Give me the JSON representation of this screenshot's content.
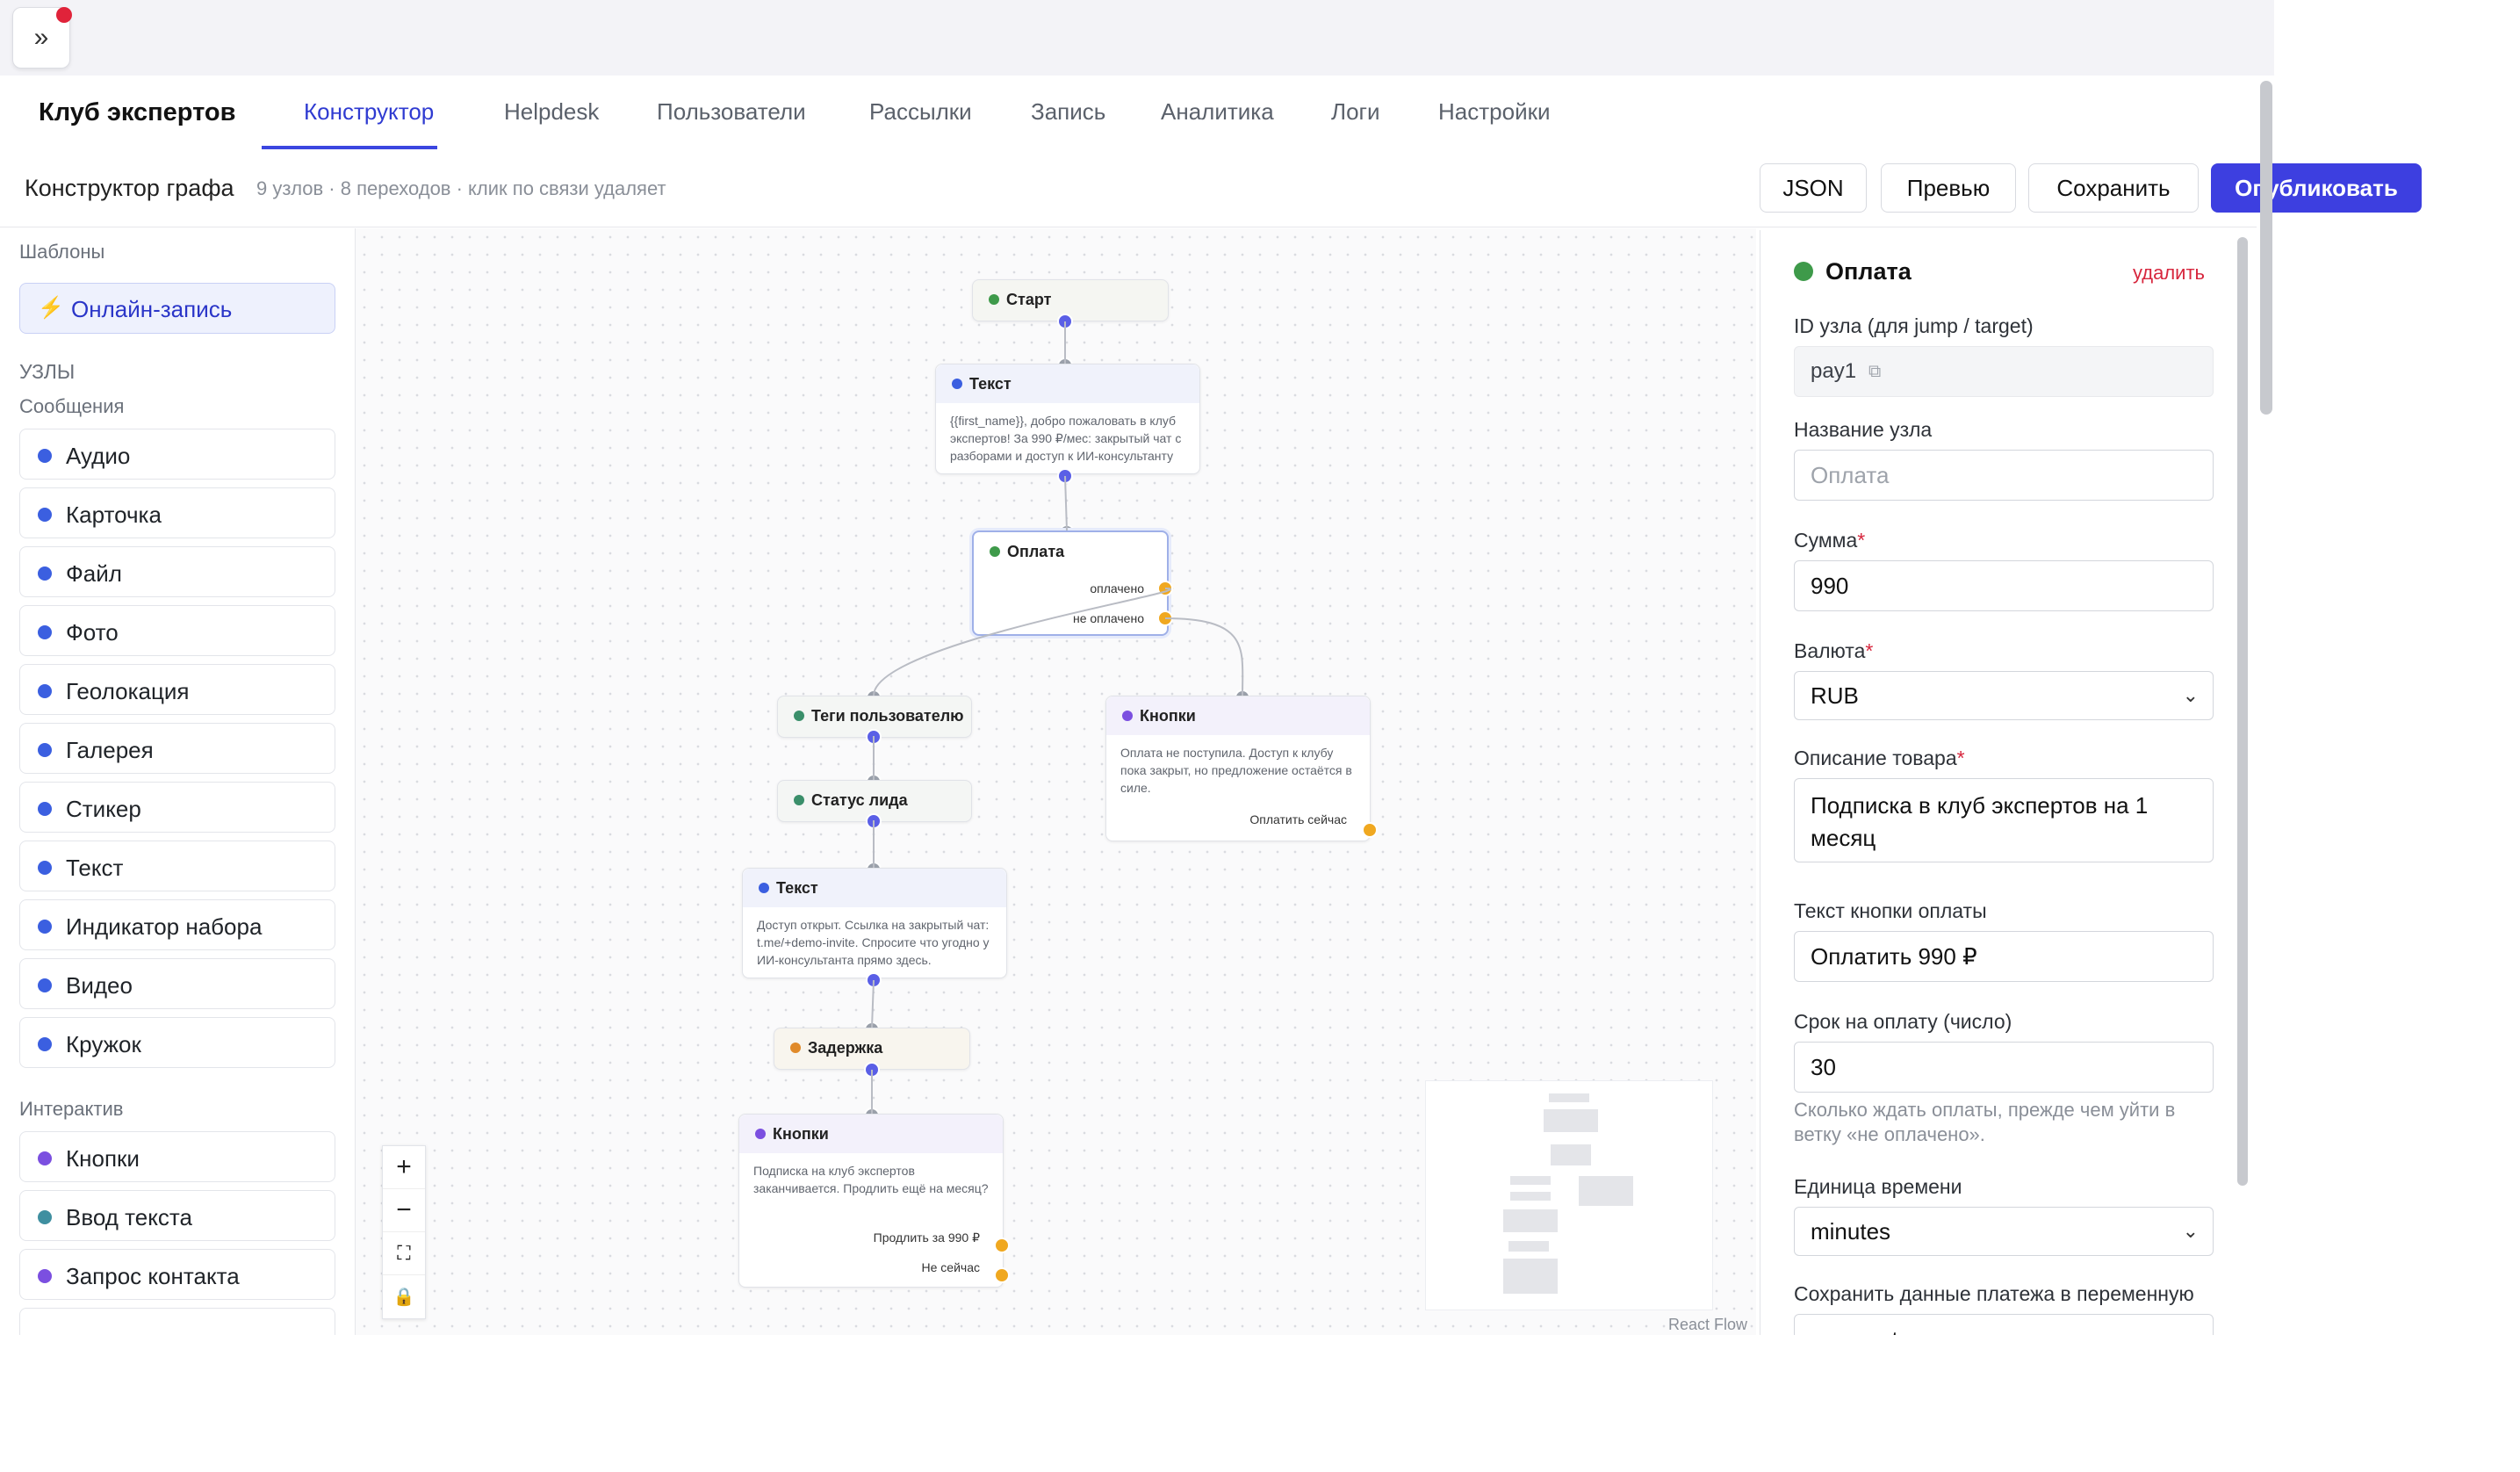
{
  "window": {
    "expand_icon": "»"
  },
  "nav": {
    "brand": "Клуб экспертов",
    "tabs": [
      "Конструктор",
      "Helpdesk",
      "Пользователи",
      "Рассылки",
      "Запись",
      "Аналитика",
      "Логи",
      "Настройки"
    ],
    "active_tab": "Конструктор"
  },
  "toolbar": {
    "title": "Конструктор графа",
    "subtitle": "9 узлов · 8 переходов · клик по связи удаляет",
    "json_label": "JSON",
    "preview_label": "Превью",
    "save_label": "Сохранить",
    "publish_label": "Опубликовать"
  },
  "sidebar": {
    "templates_heading": "Шаблоны",
    "template_item": "Онлайн-запись",
    "nodes_heading": "УЗЛЫ",
    "messages_heading": "Сообщения",
    "messages": [
      "Аудио",
      "Карточка",
      "Файл",
      "Фото",
      "Геолокация",
      "Галерея",
      "Стикер",
      "Текст",
      "Индикатор набора",
      "Видео",
      "Кружок"
    ],
    "interactive_heading": "Интерактив",
    "interactive": [
      "Кнопки",
      "Ввод текста",
      "Запрос контакта"
    ]
  },
  "canvas": {
    "nodes": {
      "start": {
        "title": "Старт"
      },
      "text1": {
        "title": "Текст",
        "body": "{{first_name}}, добро пожаловать в клуб экспертов! За 990 ₽/мес: закрытый чат с разборами и доступ к ИИ-консультанту по маркетингу."
      },
      "pay": {
        "title": "Оплата",
        "port_paid": "оплачено",
        "port_unpaid": "не оплачено"
      },
      "tags": {
        "title": "Теги пользователю"
      },
      "buttons1": {
        "title": "Кнопки",
        "body": "Оплата не поступила. Доступ к клубу пока закрыт, но предложение остаётся в силе.",
        "port1": "Оплатить сейчас"
      },
      "status": {
        "title": "Статус лида"
      },
      "text2": {
        "title": "Текст",
        "body": "Доступ открыт. Ссылка на закрытый чат: t.me/+demo-invite. Спросите что угодно у ИИ-консультанта прямо здесь."
      },
      "delay": {
        "title": "Задержка"
      },
      "buttons2": {
        "title": "Кнопки",
        "body": "Подписка на клуб экспертов заканчивается. Продлить ещё на месяц?",
        "port1": "Продлить за 990 ₽",
        "port2": "Не сейчас"
      }
    },
    "controls": {
      "zoom_in": "+",
      "zoom_out": "−",
      "fit": "⛶",
      "lock": "🔒"
    },
    "attribution": "React Flow"
  },
  "panel": {
    "title": "Оплата",
    "delete_label": "удалить",
    "id_label": "ID узла (для jump / target)",
    "id_value": "pay1",
    "name_label": "Название узла",
    "name_placeholder": "Оплата",
    "amount_label": "Сумма",
    "amount_value": "990",
    "currency_label": "Валюта",
    "currency_value": "RUB",
    "desc_label": "Описание товара",
    "desc_value": "Подписка в клуб экспертов на 1 месяц",
    "btn_text_label": "Текст кнопки оплаты",
    "btn_text_value": "Оплатить 990 ₽",
    "term_label": "Срок на оплату (число)",
    "term_value": "30",
    "term_help": "Сколько ждать оплаты, прежде чем уйти в ветку «не оплачено».",
    "unit_label": "Единица времени",
    "unit_value": "minutes",
    "save_var_label": "Сохранить данные платежа в переменную",
    "save_var_value": "payment",
    "required_mark": "*"
  },
  "colors": {
    "accent": "#3d3fe0",
    "start_node": "#3e9a4a",
    "message_node": "#3b5fe0",
    "interactive_node": "#7b4fe0",
    "delay_node": "#e08a2a",
    "branch_handle": "#f0a820",
    "delete": "#d7263d"
  }
}
